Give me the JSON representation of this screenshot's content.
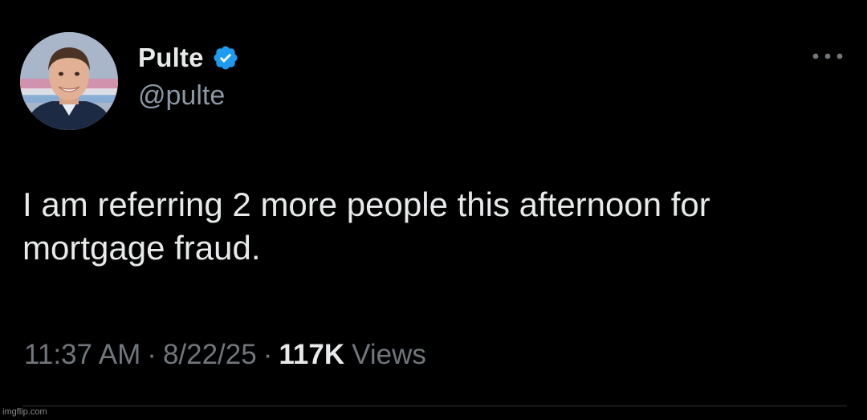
{
  "author": {
    "display_name": "Pulte",
    "handle": "@pulte",
    "verified": true,
    "avatar_icon": "profile-photo"
  },
  "tweet": {
    "text": "I am referring 2 more people this afternoon for mortgage fraud.",
    "time": "11:37 AM",
    "separator": "·",
    "date": "8/22/25",
    "views_count": "117K",
    "views_label": "Views"
  },
  "menu": {
    "icon": "more-horizontal-icon"
  },
  "watermark": {
    "text": "imgflip.com"
  },
  "colors": {
    "background": "#000000",
    "primary_text": "#e7e9ea",
    "secondary_text": "#71767b",
    "verified_badge": "#1d9bf0"
  }
}
